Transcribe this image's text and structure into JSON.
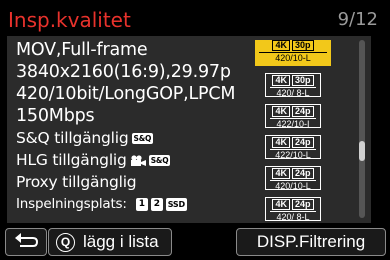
{
  "header": {
    "title": "Insp.kvalitet",
    "page": "9/12"
  },
  "details": {
    "line1": "MOV,Full-frame",
    "line2": "3840x2160(16:9),29.97p",
    "line3": "420/10bit/LongGOP,LPCM",
    "line4": "150Mbps",
    "line5": "S&Q tillgänglig",
    "line5_chip": "S&Q",
    "line6": "HLG tillgänglig",
    "line6_chip": "S&Q",
    "line7": "Proxy tillgänglig",
    "line8": "Inspelningsplats:",
    "slot1": "1",
    "slot2": "2",
    "slot3": "SSD"
  },
  "quality_list": [
    {
      "res": "4K",
      "fps": "30p",
      "codec": "420/10-L",
      "selected": true
    },
    {
      "res": "4K",
      "fps": "30p",
      "codec": "420/ 8-L",
      "selected": false
    },
    {
      "res": "4K",
      "fps": "24p",
      "codec": "422/10-I",
      "selected": false
    },
    {
      "res": "4K",
      "fps": "24p",
      "codec": "422/10-L",
      "selected": false
    },
    {
      "res": "4K",
      "fps": "24p",
      "codec": "420/10-L",
      "selected": false
    },
    {
      "res": "4K",
      "fps": "24p",
      "codec": "420/ 8-L",
      "selected": false
    }
  ],
  "scrollbar": {
    "position_fraction": 0.64,
    "thumb_fraction": 0.11
  },
  "footer": {
    "back_icon": "return-arrow-icon",
    "q_label": "Q",
    "add_label": "lägg i lista",
    "disp_label": "DISP.Filtrering"
  },
  "colors": {
    "title": "#e8322c",
    "selected": "#f2c81a",
    "panel": "#2b2b2b"
  }
}
